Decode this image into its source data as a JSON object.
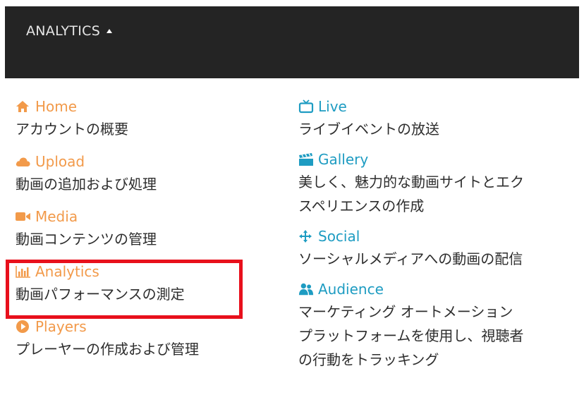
{
  "topbar": {
    "menu_label": "ANALYTICS"
  },
  "left_items": [
    {
      "title": "Home",
      "desc": "アカウントの概要",
      "icon": "home-icon"
    },
    {
      "title": "Upload",
      "desc": "動画の追加および処理",
      "icon": "cloud-upload-icon"
    },
    {
      "title": "Media",
      "desc": "動画コンテンツの管理",
      "icon": "video-camera-icon"
    },
    {
      "title": "Analytics",
      "desc": "動画パフォーマンスの測定",
      "icon": "bar-chart-icon"
    },
    {
      "title": "Players",
      "desc": "プレーヤーの作成および管理",
      "icon": "play-circle-icon"
    }
  ],
  "right_items": [
    {
      "title": "Live",
      "desc": "ライブイベントの放送",
      "icon": "tv-icon"
    },
    {
      "title": "Gallery",
      "desc_lines": [
        "美しく、魅力的な動画サイトとエク",
        "スペリエンスの作成"
      ],
      "icon": "clapperboard-icon"
    },
    {
      "title": "Social",
      "desc": "ソーシャルメディアへの動画の配信",
      "icon": "share-icon"
    },
    {
      "title": "Audience",
      "desc_lines": [
        "マーケティング オートメーション",
        "プラットフォームを使用し、視聴者",
        "の行動をトラッキング"
      ],
      "icon": "users-icon"
    }
  ],
  "colors": {
    "left_title": "#f29a4a",
    "right_title": "#1e9cc2",
    "highlight": "#e8101c",
    "topbar": "#242424"
  }
}
